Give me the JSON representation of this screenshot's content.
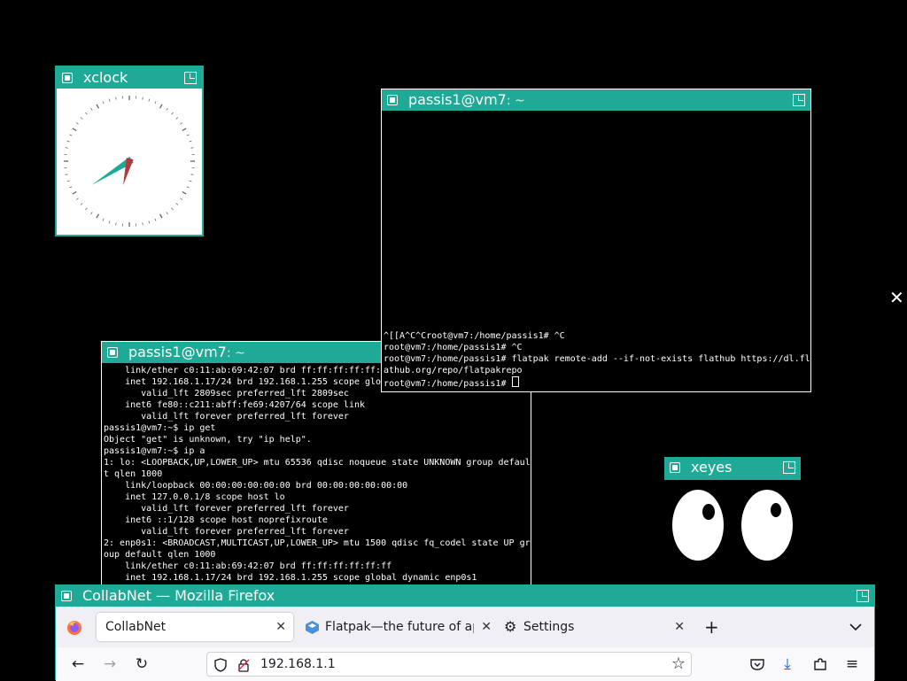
{
  "xclock": {
    "title": "xclock",
    "time": {
      "hour": 1,
      "minute": 42
    }
  },
  "terminal_top": {
    "title": "passis1@vm7",
    "title_suffix": ": ~",
    "lines": [
      "^[[A^C^Croot@vm7:/home/passis1# ^C",
      "root@vm7:/home/passis1# ^C",
      "root@vm7:/home/passis1# flatpak remote-add --if-not-exists flathub https://dl.fl",
      "athub.org/repo/flatpakrepo"
    ],
    "prompt": "root@vm7:/home/passis1# "
  },
  "terminal_bottom": {
    "title": "passis1@vm7",
    "title_suffix": ": ~",
    "lines": [
      "    link/ether c0:11:ab:69:42:07 brd ff:ff:ff:ff:ff:",
      "    inet 192.168.1.17/24 brd 192.168.1.255 scope glo",
      "       valid_lft 2809sec preferred_lft 2809sec",
      "    inet6 fe80::c211:abff:fe69:4207/64 scope link",
      "       valid_lft forever preferred_lft forever",
      "passis1@vm7:~$ ip get",
      "Object \"get\" is unknown, try \"ip help\".",
      "passis1@vm7:~$ ip a",
      "1: lo: <LOOPBACK,UP,LOWER_UP> mtu 65536 qdisc noqueue state UNKNOWN group defaul",
      "t qlen 1000",
      "    link/loopback 00:00:00:00:00:00 brd 00:00:00:00:00:00",
      "    inet 127.0.0.1/8 scope host lo",
      "       valid_lft forever preferred_lft forever",
      "    inet6 ::1/128 scope host noprefixroute",
      "       valid_lft forever preferred_lft forever",
      "2: enp0s1: <BROADCAST,MULTICAST,UP,LOWER_UP> mtu 1500 qdisc fq_codel state UP gr",
      "oup default qlen 1000",
      "    link/ether c0:11:ab:69:42:07 brd ff:ff:ff:ff:ff:ff",
      "    inet 192.168.1.17/24 brd 192.168.1.255 scope global dynamic enp0s1"
    ]
  },
  "xeyes": {
    "title": "xeyes"
  },
  "firefox": {
    "title": "CollabNet — Mozilla Firefox",
    "tabs": [
      {
        "label": "CollabNet",
        "active": true
      },
      {
        "label": "Flatpak—the future of ap",
        "active": false
      },
      {
        "label": "Settings",
        "active": false
      }
    ],
    "url": "192.168.1.1"
  },
  "colors": {
    "titlebar": "#1eaa96",
    "desktop": "#000000",
    "clock_hour_hand": "#1eaa96",
    "clock_minute_hand": "#b33a3a"
  },
  "icons": {
    "firefox": "firefox-logo-icon",
    "flatpak": "flatpak-logo-icon",
    "settings": "gear-icon",
    "new_tab": "plus-icon",
    "tab_list": "chevron-down-icon",
    "back": "arrow-left-icon",
    "forward": "arrow-right-icon",
    "reload": "reload-icon",
    "shield": "shield-icon",
    "lock": "lock-warning-icon",
    "bookmark": "star-icon",
    "pocket": "pocket-icon",
    "downloads": "download-icon",
    "extensions": "puzzle-icon",
    "menu": "hamburger-menu-icon"
  }
}
